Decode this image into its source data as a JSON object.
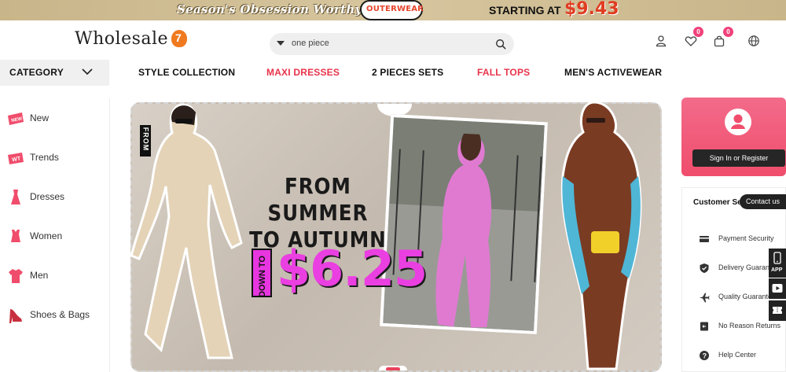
{
  "promo": {
    "slogan": "Season's Obsession Worthy",
    "tag": "OUTERWEAR",
    "starting_label": "STARTING AT",
    "starting_price": "$9.43"
  },
  "header": {
    "logo_text": "Wholesale",
    "logo_badge": "7",
    "search_value": "one piece",
    "wishlist_count": "0",
    "cart_count": "0"
  },
  "nav": {
    "category_label": "CATEGORY",
    "links": [
      {
        "label": "STYLE COLLECTION",
        "hot": false
      },
      {
        "label": "MAXI DRESSES",
        "hot": true
      },
      {
        "label": "2 PIECES SETS",
        "hot": false
      },
      {
        "label": "FALL TOPS",
        "hot": true
      },
      {
        "label": "MEN'S ACTIVEWEAR",
        "hot": false
      }
    ]
  },
  "sidebar": {
    "items": [
      {
        "label": "New",
        "icon": "new-badge-icon"
      },
      {
        "label": "Trends",
        "icon": "trends-badge-icon"
      },
      {
        "label": "Dresses",
        "icon": "dress-icon"
      },
      {
        "label": "Women",
        "icon": "women-top-icon"
      },
      {
        "label": "Men",
        "icon": "men-shirt-icon"
      },
      {
        "label": "Shoes & Bags",
        "icon": "shoe-icon"
      }
    ]
  },
  "hero": {
    "from_vertical": "FROM",
    "headline_line1": "FROM SUMMER",
    "headline_line2": "TO AUTUMN",
    "down_to": "DOWN TO",
    "price": "$6.25"
  },
  "account": {
    "sign_in_label": "Sign In or Register"
  },
  "customer_service": {
    "title": "Customer Se",
    "contact_label": "Contact us",
    "items": [
      {
        "label": "Payment Security",
        "icon": "card-icon"
      },
      {
        "label": "Delivery Guarante",
        "icon": "shield-icon"
      },
      {
        "label": "Quality Guarante",
        "icon": "plane-icon"
      },
      {
        "label": "No Reason Returns",
        "icon": "return-icon"
      },
      {
        "label": "Help Center",
        "icon": "help-icon"
      }
    ]
  },
  "floating": {
    "app_label": "APP"
  },
  "colors": {
    "accent_pink": "#f04d6c",
    "hot_link": "#e8334a",
    "price_magenta": "#ea3fe1"
  }
}
